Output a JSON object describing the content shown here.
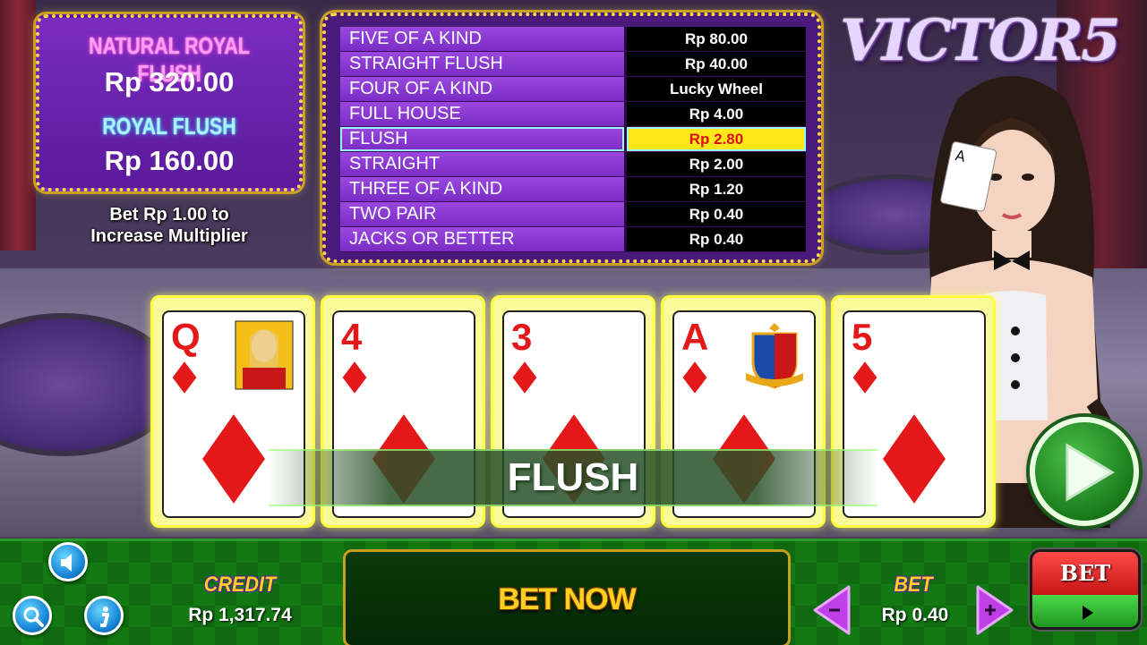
{
  "jackpot": {
    "natural_title": "NATURAL ROYAL FLUSH",
    "natural_amount": "Rp 320.00",
    "royal_title": "ROYAL FLUSH",
    "royal_amount": "Rp 160.00"
  },
  "bet_hint": {
    "line1": "Bet Rp 1.00 to",
    "line2": "Increase Multiplier"
  },
  "logo": "VICTOR5",
  "paytable": [
    {
      "hand": "FIVE OF A KIND",
      "payout": "Rp 80.00",
      "active": false
    },
    {
      "hand": "STRAIGHT FLUSH",
      "payout": "Rp 40.00",
      "active": false
    },
    {
      "hand": "FOUR OF A KIND",
      "payout": "Lucky Wheel",
      "active": false
    },
    {
      "hand": "FULL HOUSE",
      "payout": "Rp 4.00",
      "active": false
    },
    {
      "hand": "FLUSH",
      "payout": "Rp 2.80",
      "active": true
    },
    {
      "hand": "STRAIGHT",
      "payout": "Rp 2.00",
      "active": false
    },
    {
      "hand": "THREE OF A KIND",
      "payout": "Rp 1.20",
      "active": false
    },
    {
      "hand": "TWO PAIR",
      "payout": "Rp 0.40",
      "active": false
    },
    {
      "hand": "JACKS OR BETTER",
      "payout": "Rp 0.40",
      "active": false
    }
  ],
  "cards": [
    {
      "rank": "Q",
      "suit": "diamonds",
      "face_icon": "queen-face-icon"
    },
    {
      "rank": "4",
      "suit": "diamonds",
      "face_icon": ""
    },
    {
      "rank": "3",
      "suit": "diamonds",
      "face_icon": ""
    },
    {
      "rank": "A",
      "suit": "diamonds",
      "face_icon": "crest-emblem-icon"
    },
    {
      "rank": "5",
      "suit": "diamonds",
      "face_icon": ""
    }
  ],
  "result": "FLUSH",
  "footer": {
    "credit_label": "CREDIT",
    "credit_value": "Rp 1,317.74",
    "bet_now": "BET NOW",
    "bet_label": "BET",
    "bet_value": "Rp 0.40",
    "bet_button": "BET"
  },
  "colors": {
    "accent_gold": "#ffd84a",
    "panel_purple": "#7a2cc0",
    "highlight_yellow": "#ffe818",
    "highlight_red": "#e01010",
    "table_green": "#0f6a0f",
    "diamond_red": "#e41818"
  }
}
